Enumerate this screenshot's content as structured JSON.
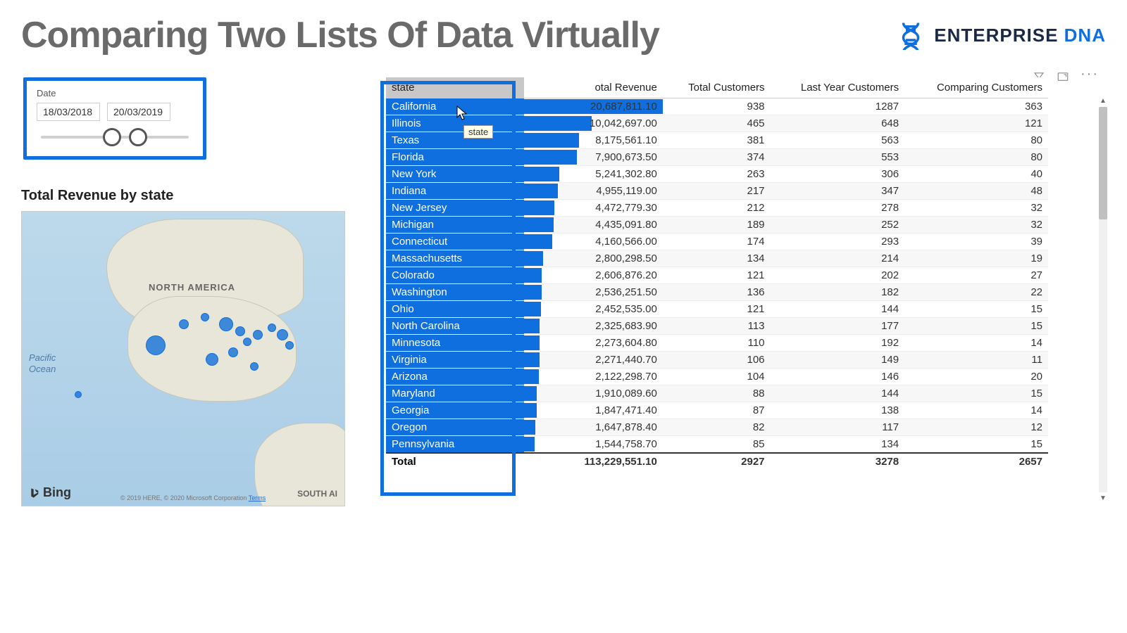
{
  "title": "Comparing Two Lists Of Data Virtually",
  "brand": {
    "name1": "ENTERPRISE ",
    "name2": "DNA"
  },
  "date_slicer": {
    "label": "Date",
    "from": "18/03/2018",
    "to": "20/03/2019"
  },
  "map": {
    "title": "Total Revenue by state",
    "na_label": "NORTH AMERICA",
    "sa_label": "SOUTH AI",
    "ocean_label": "Pacific\nOcean",
    "provider": "Bing",
    "attribution": "© 2019 HERE, © 2020 Microsoft Corporation",
    "terms": "Terms"
  },
  "toolbar": {
    "filter": "filter",
    "focus": "focus-mode",
    "more": "more"
  },
  "tooltip": "state",
  "table": {
    "headers": [
      "state",
      "otal Revenue",
      "Total Customers",
      "Last Year Customers",
      "Comparing Customers"
    ],
    "rows": [
      {
        "state": "California",
        "rev": "20,687,811.10",
        "revn": 20687811.1,
        "tc": "938",
        "ly": "1287",
        "cc": "363"
      },
      {
        "state": "Illinois",
        "rev": "10,042,697.00",
        "revn": 10042697.0,
        "tc": "465",
        "ly": "648",
        "cc": "121"
      },
      {
        "state": "Texas",
        "rev": "8,175,561.10",
        "revn": 8175561.1,
        "tc": "381",
        "ly": "563",
        "cc": "80"
      },
      {
        "state": "Florida",
        "rev": "7,900,673.50",
        "revn": 7900673.5,
        "tc": "374",
        "ly": "553",
        "cc": "80"
      },
      {
        "state": "New York",
        "rev": "5,241,302.80",
        "revn": 5241302.8,
        "tc": "263",
        "ly": "306",
        "cc": "40"
      },
      {
        "state": "Indiana",
        "rev": "4,955,119.00",
        "revn": 4955119.0,
        "tc": "217",
        "ly": "347",
        "cc": "48"
      },
      {
        "state": "New Jersey",
        "rev": "4,472,779.30",
        "revn": 4472779.3,
        "tc": "212",
        "ly": "278",
        "cc": "32"
      },
      {
        "state": "Michigan",
        "rev": "4,435,091.80",
        "revn": 4435091.8,
        "tc": "189",
        "ly": "252",
        "cc": "32"
      },
      {
        "state": "Connecticut",
        "rev": "4,160,566.00",
        "revn": 4160566.0,
        "tc": "174",
        "ly": "293",
        "cc": "39"
      },
      {
        "state": "Massachusetts",
        "rev": "2,800,298.50",
        "revn": 2800298.5,
        "tc": "134",
        "ly": "214",
        "cc": "19"
      },
      {
        "state": "Colorado",
        "rev": "2,606,876.20",
        "revn": 2606876.2,
        "tc": "121",
        "ly": "202",
        "cc": "27"
      },
      {
        "state": "Washington",
        "rev": "2,536,251.50",
        "revn": 2536251.5,
        "tc": "136",
        "ly": "182",
        "cc": "22"
      },
      {
        "state": "Ohio",
        "rev": "2,452,535.00",
        "revn": 2452535.0,
        "tc": "121",
        "ly": "144",
        "cc": "15"
      },
      {
        "state": "North Carolina",
        "rev": "2,325,683.90",
        "revn": 2325683.9,
        "tc": "113",
        "ly": "177",
        "cc": "15"
      },
      {
        "state": "Minnesota",
        "rev": "2,273,604.80",
        "revn": 2273604.8,
        "tc": "110",
        "ly": "192",
        "cc": "14"
      },
      {
        "state": "Virginia",
        "rev": "2,271,440.70",
        "revn": 2271440.7,
        "tc": "106",
        "ly": "149",
        "cc": "11"
      },
      {
        "state": "Arizona",
        "rev": "2,122,298.70",
        "revn": 2122298.7,
        "tc": "104",
        "ly": "146",
        "cc": "20"
      },
      {
        "state": "Maryland",
        "rev": "1,910,089.60",
        "revn": 1910089.6,
        "tc": "88",
        "ly": "144",
        "cc": "15"
      },
      {
        "state": "Georgia",
        "rev": "1,847,471.40",
        "revn": 1847471.4,
        "tc": "87",
        "ly": "138",
        "cc": "14"
      },
      {
        "state": "Oregon",
        "rev": "1,647,878.40",
        "revn": 1647878.4,
        "tc": "82",
        "ly": "117",
        "cc": "12"
      },
      {
        "state": "Pennsylvania",
        "rev": "1,544,758.70",
        "revn": 1544758.7,
        "tc": "85",
        "ly": "134",
        "cc": "15"
      }
    ],
    "total": {
      "label": "Total",
      "rev": "113,229,551.10",
      "tc": "2927",
      "ly": "3278",
      "cc": "2657"
    }
  },
  "chart_data": {
    "type": "table",
    "title": "Total Revenue by state",
    "columns": [
      "state",
      "Total Revenue",
      "Total Customers",
      "Last Year Customers",
      "Comparing Customers"
    ],
    "categories": [
      "California",
      "Illinois",
      "Texas",
      "Florida",
      "New York",
      "Indiana",
      "New Jersey",
      "Michigan",
      "Connecticut",
      "Massachusetts",
      "Colorado",
      "Washington",
      "Ohio",
      "North Carolina",
      "Minnesota",
      "Virginia",
      "Arizona",
      "Maryland",
      "Georgia",
      "Oregon",
      "Pennsylvania"
    ],
    "series": [
      {
        "name": "Total Revenue",
        "values": [
          20687811.1,
          10042697.0,
          8175561.1,
          7900673.5,
          5241302.8,
          4955119.0,
          4472779.3,
          4435091.8,
          4160566.0,
          2800298.5,
          2606876.2,
          2536251.5,
          2452535.0,
          2325683.9,
          2273604.8,
          2271440.7,
          2122298.7,
          1910089.6,
          1847471.4,
          1647878.4,
          1544758.7
        ]
      },
      {
        "name": "Total Customers",
        "values": [
          938,
          465,
          381,
          374,
          263,
          217,
          212,
          189,
          174,
          134,
          121,
          136,
          121,
          113,
          110,
          106,
          104,
          88,
          87,
          82,
          85
        ]
      },
      {
        "name": "Last Year Customers",
        "values": [
          1287,
          648,
          563,
          553,
          306,
          347,
          278,
          252,
          293,
          214,
          202,
          182,
          144,
          177,
          192,
          149,
          146,
          144,
          138,
          117,
          134
        ]
      },
      {
        "name": "Comparing Customers",
        "values": [
          363,
          121,
          80,
          80,
          40,
          48,
          32,
          32,
          39,
          19,
          27,
          22,
          15,
          15,
          14,
          11,
          20,
          15,
          14,
          12,
          15
        ]
      }
    ],
    "totals": {
      "Total Revenue": 113229551.1,
      "Total Customers": 2927,
      "Last Year Customers": 3278,
      "Comparing Customers": 2657
    }
  }
}
